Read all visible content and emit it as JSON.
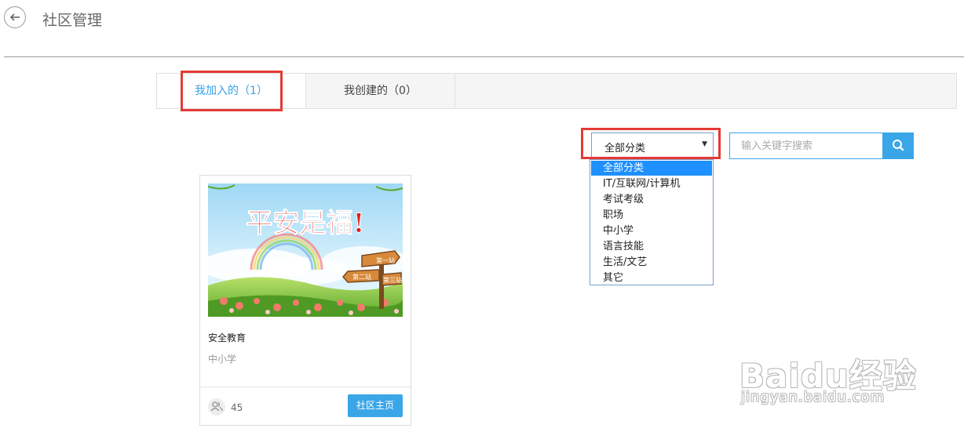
{
  "header": {
    "title": "社区管理"
  },
  "tabs": [
    {
      "label": "我加入的（1）"
    },
    {
      "label": "我创建的（0）"
    }
  ],
  "filter": {
    "selected": "全部分类",
    "options": [
      "全部分类",
      "IT/互联网/计算机",
      "考试考级",
      "职场",
      "中小学",
      "语言技能",
      "生活/文艺",
      "其它"
    ],
    "search_placeholder": "输入关键字搜索"
  },
  "community_card": {
    "image_text": "平安是福!",
    "sign_labels": [
      "第一站",
      "第二站",
      "第三站"
    ],
    "title": "安全教育",
    "category": "中小学",
    "member_count": "45",
    "home_button": "社区主页"
  },
  "watermark": {
    "brand": "Baidu经验",
    "url": "jingyan.baidu.com"
  },
  "colors": {
    "accent": "#3aa6e8",
    "highlight_frame": "#e53935",
    "selected_option": "#1e90ff"
  }
}
